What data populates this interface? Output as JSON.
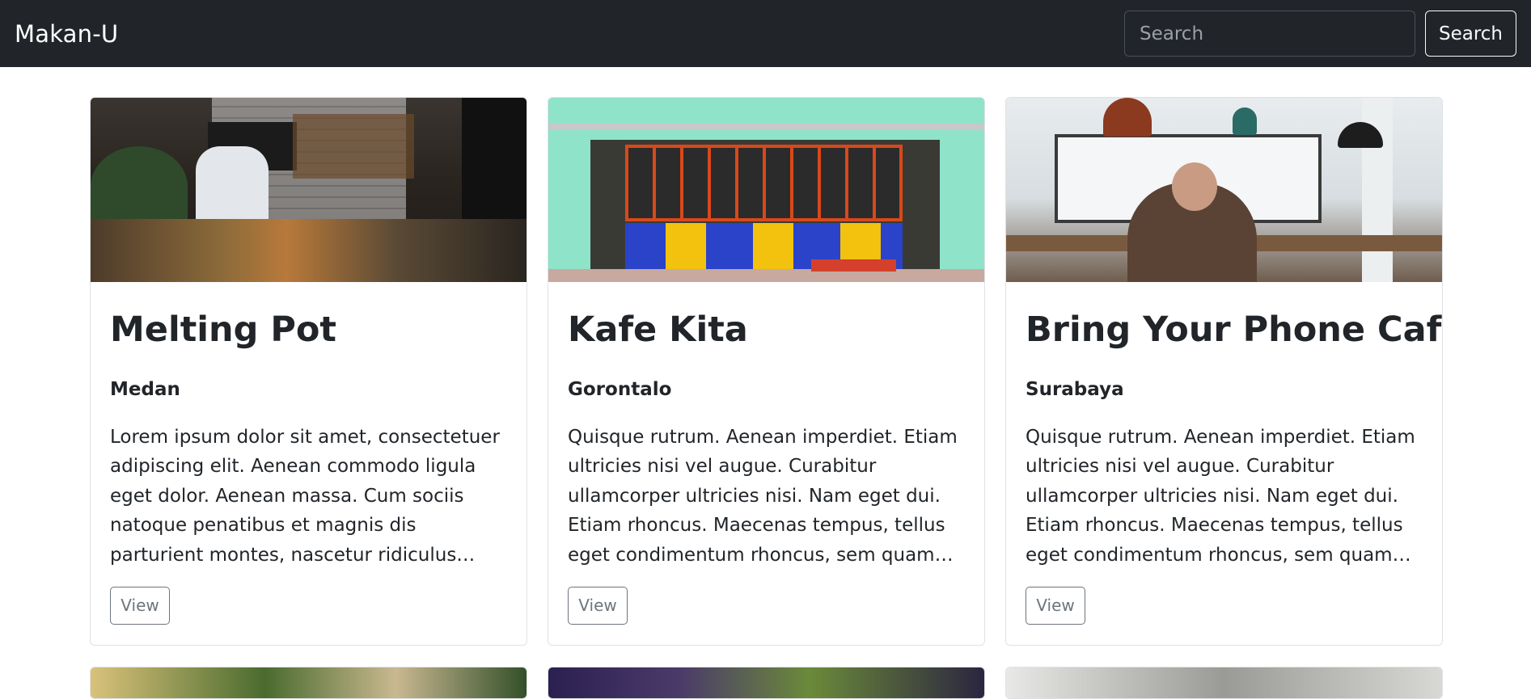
{
  "navbar": {
    "brand": "Makan-U",
    "search": {
      "placeholder": "Search",
      "button_label": "Search"
    }
  },
  "cards": [
    {
      "title": "Melting Pot",
      "location": "Medan",
      "description": "Lorem ipsum dolor sit amet, consectetuer adipiscing elit. Aenean commodo ligula eget dolor. Aenean massa. Cum sociis natoque penatibus et magnis dis parturient montes, nascetur ridiculus mus. Donec quam felis, ultricies nec, pellentesque eu, pretium quis, sem.",
      "button_label": "View"
    },
    {
      "title": "Kafe Kita",
      "location": "Gorontalo",
      "description": "Quisque rutrum. Aenean imperdiet. Etiam ultricies nisi vel augue. Curabitur ullamcorper ultricies nisi. Nam eget dui. Etiam rhoncus. Maecenas tempus, tellus eget condimentum rhoncus, sem quam semper libero, sit amet adipiscing sem neque sed ipsum.",
      "button_label": "View"
    },
    {
      "title": "Bring Your Phone Cafe",
      "location": "Surabaya",
      "description": "Quisque rutrum. Aenean imperdiet. Etiam ultricies nisi vel augue. Curabitur ullamcorper ultricies nisi. Nam eget dui. Etiam rhoncus. Maecenas tempus, tellus eget condimentum rhoncus, sem quam semper libero, sit amet adipiscing sem neque sed ipsum.",
      "button_label": "View"
    }
  ],
  "colors": {
    "navbar_bg": "#212529",
    "card_border": "#dee2e6",
    "button_outline": "#6c757d"
  }
}
